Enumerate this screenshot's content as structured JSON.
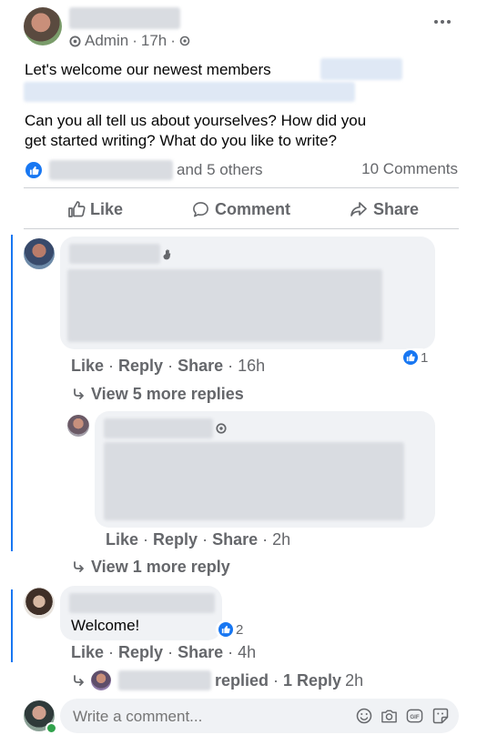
{
  "post": {
    "role": "Admin",
    "time": "17h",
    "dot": "·",
    "text_line1": "Let's welcome our newest members",
    "text_line2": "Can you all tell us about yourselves? How did you",
    "text_line3": "get started writing? What do you like to write?",
    "reactions_others": "and 5 others",
    "comments_count": "10 Comments",
    "actions": {
      "like": "Like",
      "comment": "Comment",
      "share": "Share"
    }
  },
  "comments": [
    {
      "like": "Like",
      "reply": "Reply",
      "share": "Share",
      "time": "16h",
      "reactions": "1",
      "view_more": "View 5 more replies"
    },
    {
      "like": "Like",
      "reply": "Reply",
      "share": "Share",
      "time": "2h",
      "view_more": "View 1 more reply"
    },
    {
      "text": "Welcome!",
      "reactions": "2",
      "like": "Like",
      "reply": "Reply",
      "share": "Share",
      "time": "4h",
      "replied": "replied",
      "reply_count": "1 Reply",
      "reply_time": "2h"
    }
  ],
  "composer": {
    "placeholder": "Write a comment..."
  },
  "colors": {
    "accent": "#1877f2",
    "muted": "#65676b",
    "bubble": "#f0f2f5",
    "thread_line": "#1877f2"
  }
}
